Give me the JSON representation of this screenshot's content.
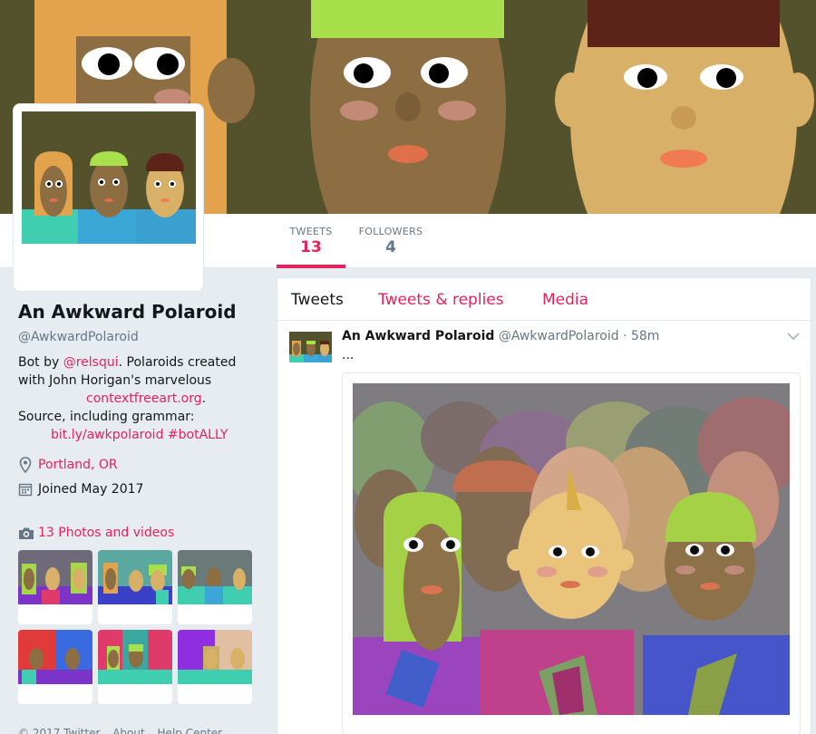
{
  "nav": {
    "stats": [
      {
        "label": "TWEETS",
        "value": "13"
      },
      {
        "label": "FOLLOWERS",
        "value": "4"
      }
    ]
  },
  "profile": {
    "name": "An Awkward Polaroid",
    "handle": "@AwkwardPolaroid",
    "bio": {
      "by": "Bot by ",
      "author_link": "@relsqui",
      "line1_rest": ". Polaroids created",
      "line2": "with John Horigan's marvelous",
      "site_link": "contextfreeart.org",
      "period": ".",
      "line4": "Source, including grammar:",
      "source_link": "bit.ly/awkpolaroid",
      "hashtag": "#botALLY"
    },
    "location": "Portland, OR",
    "joined": "Joined May 2017"
  },
  "photos": {
    "label": "13 Photos and videos"
  },
  "footer": {
    "items": [
      "© 2017 Twitter",
      "About",
      "Help Center"
    ]
  },
  "timeline": {
    "tabs": [
      "Tweets",
      "Tweets & replies",
      "Media"
    ],
    "tweet": {
      "name": "An Awkward Polaroid",
      "handle": "@AwkwardPolaroid",
      "separator": "·",
      "time": "58m",
      "text": "..."
    }
  },
  "colors": {
    "accent": "#e0245e",
    "muted": "#657786",
    "banner_bg": "#54522c"
  },
  "icons": {
    "location": "map-pin-icon",
    "joined": "calendar-icon",
    "photos": "camera-icon",
    "tweet_menu": "chevron-down-icon"
  }
}
